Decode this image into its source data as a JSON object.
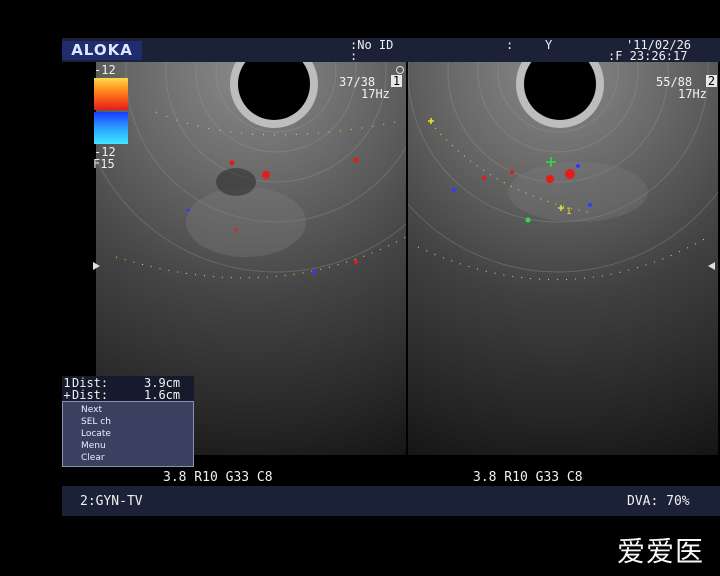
{
  "header": {
    "brand": "ALOKA",
    "patient_id": ":No ID",
    "sep": ":",
    "flag": "Y",
    "date": "'11/02/26",
    "time": ":F 23:26:17",
    "blank": ":"
  },
  "color_scale": {
    "top_value": "12",
    "bottom_value": "12",
    "filter": "F15",
    "top_colors": [
      "#ffd84a",
      "#ff8a1a",
      "#e81a1a"
    ],
    "bottom_colors": [
      "#1a3cff",
      "#2aa0ff",
      "#3fe8ff"
    ]
  },
  "left_panel": {
    "frame_counter": "37/38",
    "frame_badge": "1",
    "rate": "17Hz",
    "params": "3.8 R10 G33 C8"
  },
  "right_panel": {
    "frame_counter": "55/88",
    "frame_badge": "2",
    "rate": "17Hz",
    "params": "3.8 R10 G33 C8"
  },
  "measurements": [
    {
      "marker": "1",
      "label": "Dist:",
      "value": "3.9cm"
    },
    {
      "marker": "+",
      "label": "Dist:",
      "value": "1.6cm"
    }
  ],
  "menu": {
    "items": [
      "Next",
      "SEL ch",
      "Locate",
      "Menu",
      "Clear"
    ]
  },
  "footer": {
    "preset": "2:GYN-TV",
    "dva": "DVA: 70%"
  },
  "watermark": "爱爱医",
  "colors": {
    "header_bg": "#1b2238",
    "brand_bg": "#1f2c6e",
    "menu_bg": "#3a4060",
    "caliper_yellow": "#e8e030",
    "caliper_green": "#30e040",
    "doppler_red": "#e81a1a",
    "doppler_blue": "#2a3cff"
  }
}
